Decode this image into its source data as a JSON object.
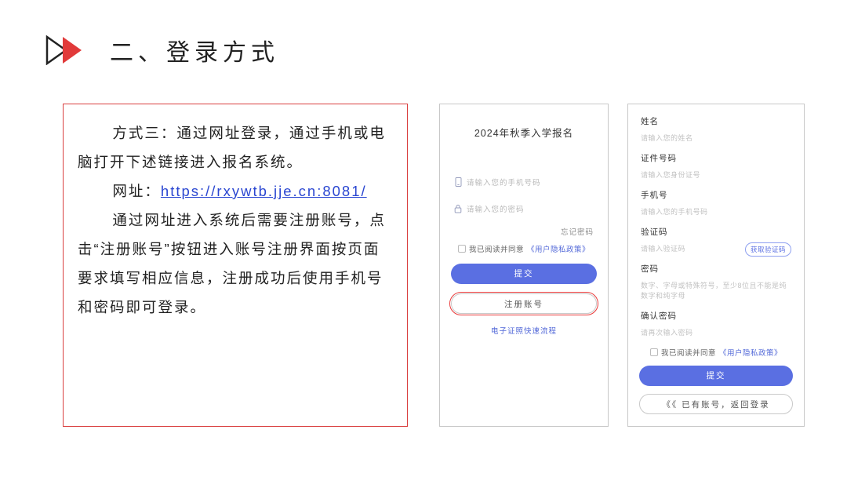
{
  "header": {
    "title": "二、登录方式"
  },
  "text": {
    "p1": "方式三：通过网址登录，通过手机或电脑打开下述链接进入报名系统。",
    "url_label": "网址：",
    "url": "https://rxywtb.jje.cn:8081/",
    "p3": "通过网址进入系统后需要注册账号，点击“注册账号”按钮进入账号注册界面按页面要求填写相应信息，注册成功后使用手机号和密码即可登录。"
  },
  "login": {
    "title": "2024年秋季入学报名",
    "phone_placeholder": "请输入您的手机号码",
    "password_placeholder": "请输入您的密码",
    "forgot": "忘记密码",
    "agree_prefix": "我已阅读并同意",
    "agree_link": "《用户隐私政策》",
    "submit": "提交",
    "register": "注册账号",
    "verify_link": "电子证照快速流程"
  },
  "signup": {
    "fields": {
      "name": {
        "label": "姓名",
        "ph": "请输入您的姓名"
      },
      "id": {
        "label": "证件号码",
        "ph": "请输入您身份证号"
      },
      "phone": {
        "label": "手机号",
        "ph": "请输入您的手机号码"
      },
      "code": {
        "label": "验证码",
        "ph": "请输入验证码",
        "get": "获取验证码"
      },
      "pwd": {
        "label": "密码",
        "ph": "数字、字母或特殊符号，至少8位且不能是纯数字和纯字母"
      },
      "pwd2": {
        "label": "确认密码",
        "ph": "请再次输入密码"
      }
    },
    "agree_prefix": "我已阅读并同意",
    "agree_link": "《用户隐私政策》",
    "submit": "提交",
    "back": "《《 已有账号，返回登录"
  }
}
